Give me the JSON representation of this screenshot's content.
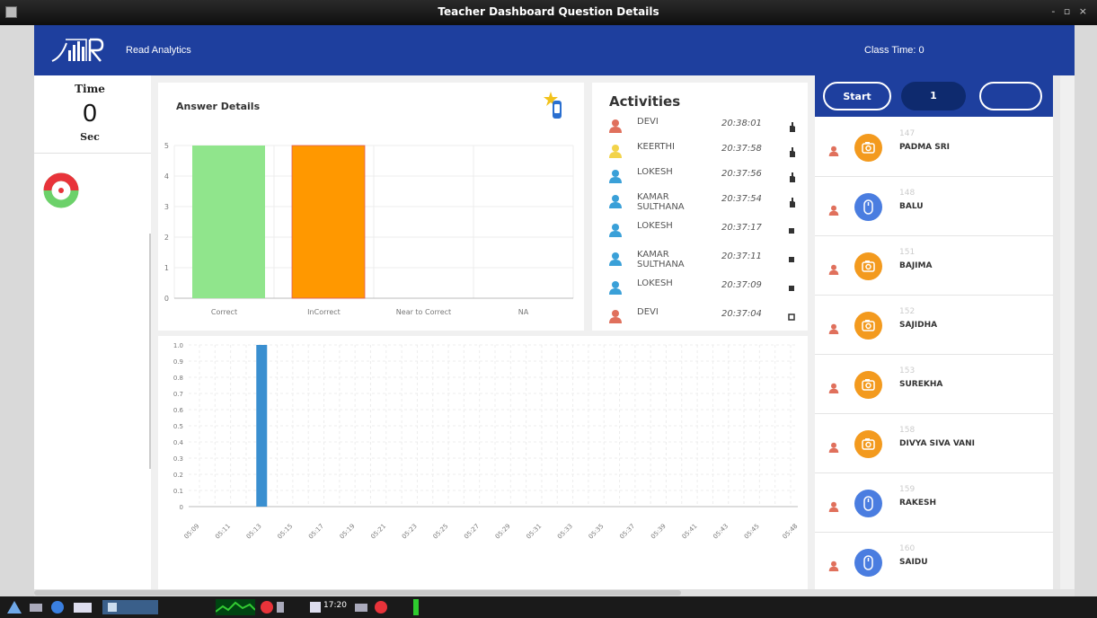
{
  "window": {
    "title": "Teacher Dashboard Question Details",
    "controls": "- ▫ ×"
  },
  "header": {
    "brand": "Read Analytics",
    "class_time_label": "Class Time:",
    "class_time_value": "0"
  },
  "timer": {
    "label": "Time",
    "value": "0",
    "unit": "Sec"
  },
  "answer_details": {
    "title": "Answer Details",
    "chart_data": {
      "type": "bar",
      "categories": [
        "Correct",
        "InCorrect",
        "Near to Correct",
        "NA"
      ],
      "values": [
        5,
        5,
        0,
        0
      ],
      "colors": [
        "#90e58c",
        "#ff9800",
        "#cccccc",
        "#cccccc"
      ],
      "ylim": [
        0,
        5
      ],
      "yticks": [
        "0",
        "1",
        "2",
        "3",
        "4",
        "5"
      ],
      "grid": true
    }
  },
  "timeline": {
    "chart_data": {
      "type": "bar",
      "categories": [
        "05:09",
        "05:11",
        "05:13",
        "05:15",
        "05:17",
        "05:19",
        "05:21",
        "05:23",
        "05:25",
        "05:27",
        "05:29",
        "05:31",
        "05:33",
        "05:35",
        "05:37",
        "05:39",
        "05:41",
        "05:43",
        "05:45",
        "05:48"
      ],
      "values": [
        0,
        0,
        1,
        0,
        0,
        0,
        0,
        0,
        0,
        0,
        0,
        0,
        0,
        0,
        0,
        0,
        0,
        0,
        0,
        0
      ],
      "color": "#3a8fd0",
      "ylim": [
        0,
        1.0
      ],
      "yticks": [
        "0",
        "0.1",
        "0.2",
        "0.3",
        "0.4",
        "0.5",
        "0.6",
        "0.7",
        "0.8",
        "0.9",
        "1.0"
      ],
      "grid": true
    }
  },
  "activities": {
    "title": "Activities",
    "items": [
      {
        "name": "DEVI",
        "time": "20:38:01",
        "person_color": "#e0705c",
        "mark": "hand"
      },
      {
        "name": "KEERTHI",
        "time": "20:37:58",
        "person_color": "#f2d34a",
        "mark": "hand"
      },
      {
        "name": "LOKESH",
        "time": "20:37:56",
        "person_color": "#3aa0d8",
        "mark": "hand"
      },
      {
        "name": "KAMAR SULTHANA",
        "time": "20:37:54",
        "person_color": "#3aa0d8",
        "mark": "hand"
      },
      {
        "name": "LOKESH",
        "time": "20:37:17",
        "person_color": "#3aa0d8",
        "mark": "square"
      },
      {
        "name": "KAMAR SULTHANA",
        "time": "20:37:11",
        "person_color": "#3aa0d8",
        "mark": "square"
      },
      {
        "name": "LOKESH",
        "time": "20:37:09",
        "person_color": "#3aa0d8",
        "mark": "square"
      },
      {
        "name": "DEVI",
        "time": "20:37:04",
        "person_color": "#e0705c",
        "mark": "square-outline"
      }
    ]
  },
  "controls": {
    "start_label": "Start",
    "count": "1",
    "empty_label": ""
  },
  "students": [
    {
      "id": "147",
      "name": "PADMA SRI",
      "avatar_color": "#f39a1e",
      "icon": "camera-icon"
    },
    {
      "id": "148",
      "name": "BALU",
      "avatar_color": "#4a7de0",
      "icon": "mouse-icon"
    },
    {
      "id": "151",
      "name": "BAJIMA",
      "avatar_color": "#f39a1e",
      "icon": "camera-icon"
    },
    {
      "id": "152",
      "name": "SAJIDHA",
      "avatar_color": "#f39a1e",
      "icon": "camera-icon"
    },
    {
      "id": "153",
      "name": "SUREKHA",
      "avatar_color": "#f39a1e",
      "icon": "camera-icon"
    },
    {
      "id": "158",
      "name": "DIVYA SIVA VANI",
      "avatar_color": "#f39a1e",
      "icon": "camera-icon"
    },
    {
      "id": "159",
      "name": "RAKESH",
      "avatar_color": "#4a7de0",
      "icon": "mouse-icon"
    },
    {
      "id": "160",
      "name": "SAIDU",
      "avatar_color": "#4a7de0",
      "icon": "mouse-icon"
    }
  ],
  "taskbar": {
    "clock": "17:20"
  }
}
